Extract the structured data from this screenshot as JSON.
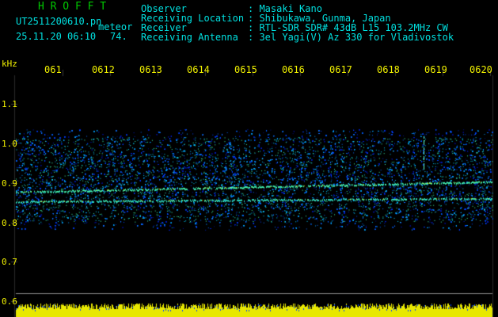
{
  "header": {
    "app_title": "H R O F F T",
    "file_name": "UT2511200610.pn",
    "event_type": "meteor",
    "datetime": "25.11.20 06:10",
    "count": "74.",
    "info": [
      {
        "label": "Observer",
        "value": ": Masaki Kano"
      },
      {
        "label": "Receiving Location",
        "value": ": Shibukawa, Gunma, Japan"
      },
      {
        "label": "Receiver",
        "value": ": RTL-SDR SDR# 43dB L15 103.2MHz CW"
      },
      {
        "label": "Receiving Antenna",
        "value": ": 3el Yagi(V) Az 330 for Vladivostok"
      }
    ]
  },
  "axis": {
    "unit": "kHz",
    "y_ticks": [
      "1.1",
      "1.0",
      "0.9",
      "0.8",
      "0.7",
      "0.6"
    ],
    "time_ticks": [
      "061",
      "0612",
      "0613",
      "0614",
      "0615",
      "0616",
      "0617",
      "0618",
      "0619",
      "0620"
    ]
  },
  "colors": {
    "background": "#000000",
    "noise_dark": "#0018a0",
    "noise_mid": "#0050ff",
    "signal": "#00ffd0",
    "signal_hot": "#f0f000",
    "label_yellow": "#f0f000",
    "label_cyan": "#00e0e0",
    "title_green": "#00c800"
  }
}
